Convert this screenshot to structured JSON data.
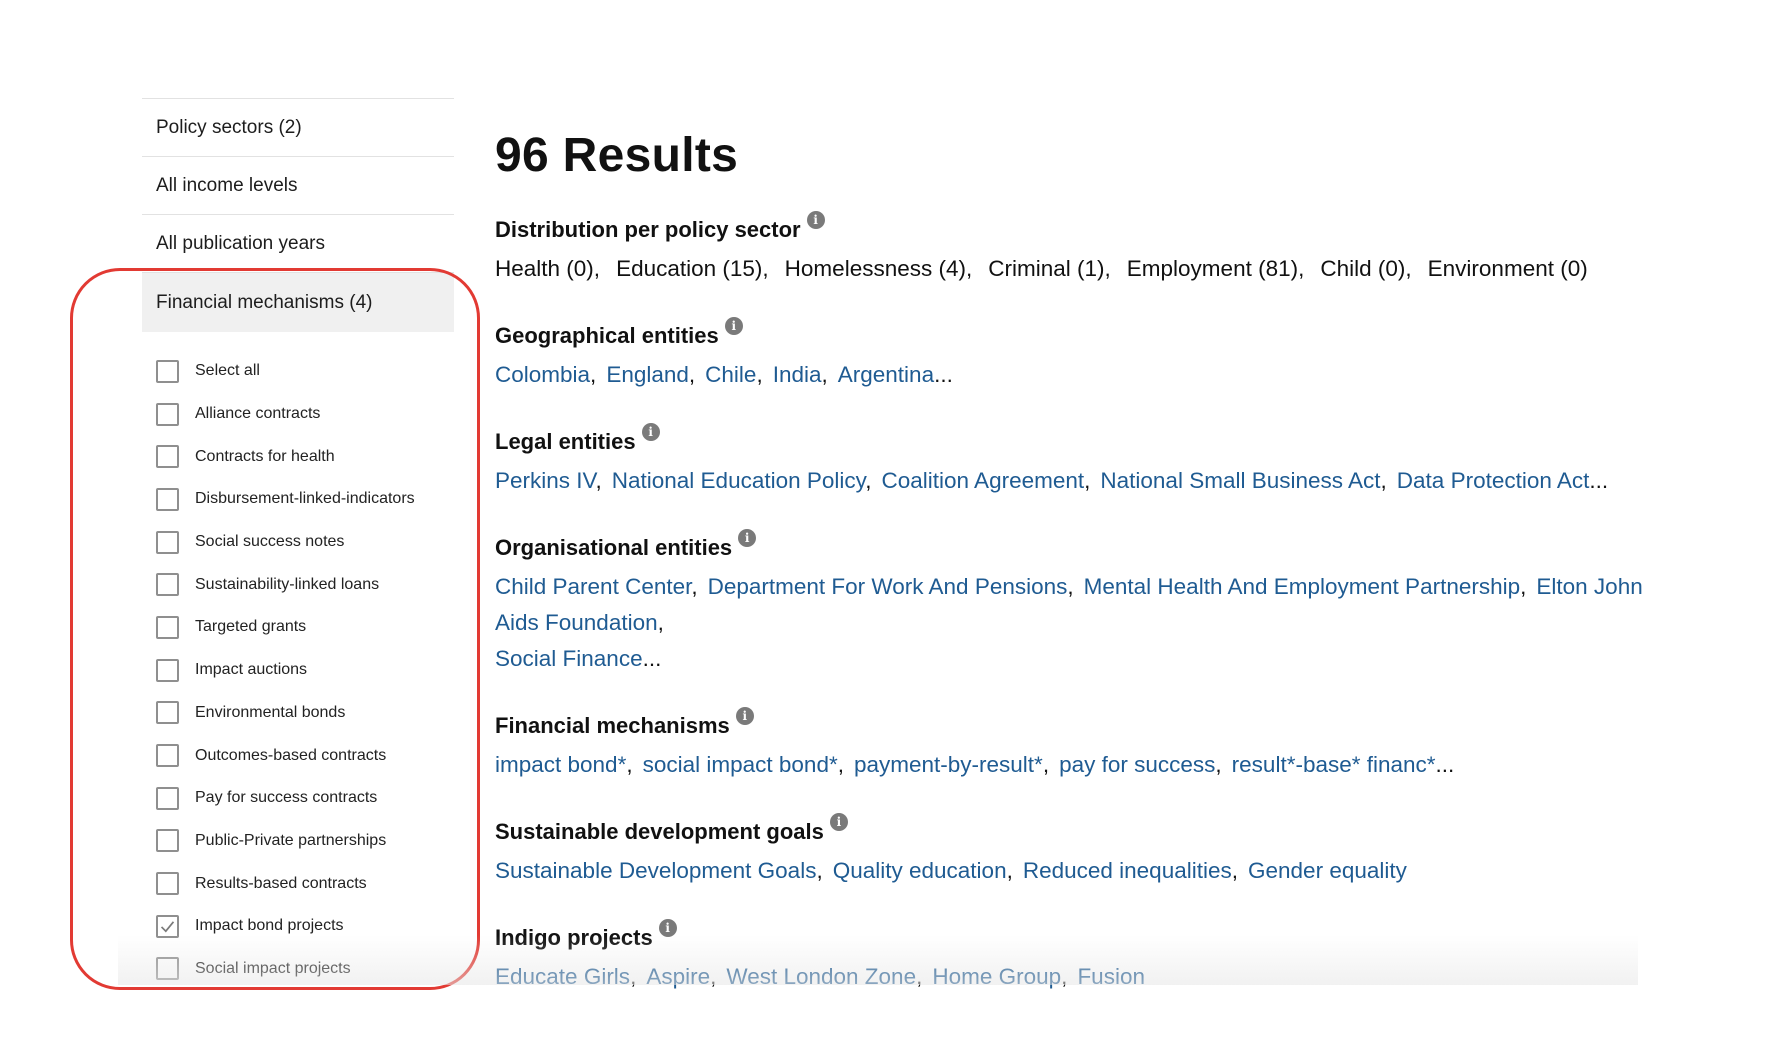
{
  "sidebar": {
    "filters": [
      {
        "label": "Policy sectors (2)"
      },
      {
        "label": "All income levels"
      },
      {
        "label": "All publication years"
      }
    ],
    "active_filter": {
      "label": "Financial mechanisms (4)"
    },
    "options": [
      {
        "label": "Select all",
        "checked": false
      },
      {
        "label": "Alliance contracts",
        "checked": false
      },
      {
        "label": "Contracts for health",
        "checked": false
      },
      {
        "label": "Disbursement-linked-indicators",
        "checked": false
      },
      {
        "label": "Social success notes",
        "checked": false
      },
      {
        "label": "Sustainability-linked loans",
        "checked": false
      },
      {
        "label": "Targeted grants",
        "checked": false
      },
      {
        "label": "Impact auctions",
        "checked": false
      },
      {
        "label": "Environmental bonds",
        "checked": false
      },
      {
        "label": "Outcomes-based contracts",
        "checked": false
      },
      {
        "label": "Pay for success contracts",
        "checked": false
      },
      {
        "label": "Public-Private partnerships",
        "checked": false
      },
      {
        "label": "Results-based contracts",
        "checked": false
      },
      {
        "label": "Impact bond projects",
        "checked": true
      },
      {
        "label": "Social impact projects",
        "checked": false
      }
    ]
  },
  "main": {
    "results_title": "96 Results",
    "info_glyph": "i",
    "sections": {
      "distribution": {
        "title": "Distribution per policy sector",
        "items": [
          "Health (0)",
          "Education (15)",
          "Homelessness (4)",
          "Criminal (1)",
          "Employment (81)",
          "Child (0)",
          "Environment (0)"
        ]
      },
      "geographical": {
        "title": "Geographical entities",
        "items": [
          "Colombia",
          "England",
          "Chile",
          "India",
          "Argentina"
        ],
        "ellipsis": "..."
      },
      "legal": {
        "title": "Legal entities",
        "items": [
          "Perkins IV",
          "National Education Policy",
          "Coalition Agreement",
          "National Small Business Act",
          "Data Protection Act"
        ],
        "ellipsis": "..."
      },
      "organisational": {
        "title": "Organisational entities",
        "items": [
          "Child Parent Center",
          "Department For Work And Pensions",
          "Mental Health And Employment Partnership",
          "Elton John Aids Foundation",
          "Social Finance"
        ],
        "ellipsis": "..."
      },
      "financial": {
        "title": "Financial mechanisms",
        "items": [
          "impact bond*",
          "social impact bond*",
          "payment-by-result*",
          "pay for success",
          "result*-base* financ*"
        ],
        "ellipsis": "..."
      },
      "sdg": {
        "title": "Sustainable development goals",
        "items": [
          "Sustainable Development Goals",
          "Quality education",
          "Reduced inequalities",
          "Gender equality"
        ]
      },
      "indigo": {
        "title": "Indigo projects",
        "items": [
          "Educate Girls",
          "Aspire",
          "West London Zone",
          "Home Group",
          "Fusion"
        ]
      }
    }
  },
  "colors": {
    "link": "#1f5b92",
    "highlight": "#e23a33"
  }
}
